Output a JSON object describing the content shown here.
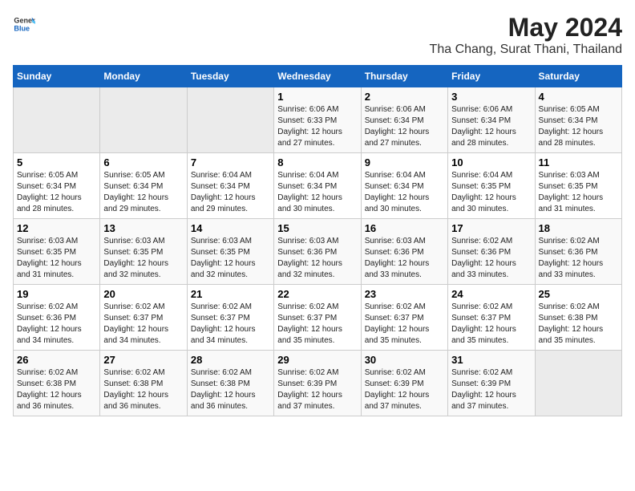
{
  "header": {
    "logo_general": "General",
    "logo_blue": "Blue",
    "title": "May 2024",
    "subtitle": "Tha Chang, Surat Thani, Thailand"
  },
  "days_of_week": [
    "Sunday",
    "Monday",
    "Tuesday",
    "Wednesday",
    "Thursday",
    "Friday",
    "Saturday"
  ],
  "weeks": [
    [
      {
        "day": "",
        "info": ""
      },
      {
        "day": "",
        "info": ""
      },
      {
        "day": "",
        "info": ""
      },
      {
        "day": "1",
        "info": "Sunrise: 6:06 AM\nSunset: 6:33 PM\nDaylight: 12 hours\nand 27 minutes."
      },
      {
        "day": "2",
        "info": "Sunrise: 6:06 AM\nSunset: 6:34 PM\nDaylight: 12 hours\nand 27 minutes."
      },
      {
        "day": "3",
        "info": "Sunrise: 6:06 AM\nSunset: 6:34 PM\nDaylight: 12 hours\nand 28 minutes."
      },
      {
        "day": "4",
        "info": "Sunrise: 6:05 AM\nSunset: 6:34 PM\nDaylight: 12 hours\nand 28 minutes."
      }
    ],
    [
      {
        "day": "5",
        "info": "Sunrise: 6:05 AM\nSunset: 6:34 PM\nDaylight: 12 hours\nand 28 minutes."
      },
      {
        "day": "6",
        "info": "Sunrise: 6:05 AM\nSunset: 6:34 PM\nDaylight: 12 hours\nand 29 minutes."
      },
      {
        "day": "7",
        "info": "Sunrise: 6:04 AM\nSunset: 6:34 PM\nDaylight: 12 hours\nand 29 minutes."
      },
      {
        "day": "8",
        "info": "Sunrise: 6:04 AM\nSunset: 6:34 PM\nDaylight: 12 hours\nand 30 minutes."
      },
      {
        "day": "9",
        "info": "Sunrise: 6:04 AM\nSunset: 6:34 PM\nDaylight: 12 hours\nand 30 minutes."
      },
      {
        "day": "10",
        "info": "Sunrise: 6:04 AM\nSunset: 6:35 PM\nDaylight: 12 hours\nand 30 minutes."
      },
      {
        "day": "11",
        "info": "Sunrise: 6:03 AM\nSunset: 6:35 PM\nDaylight: 12 hours\nand 31 minutes."
      }
    ],
    [
      {
        "day": "12",
        "info": "Sunrise: 6:03 AM\nSunset: 6:35 PM\nDaylight: 12 hours\nand 31 minutes."
      },
      {
        "day": "13",
        "info": "Sunrise: 6:03 AM\nSunset: 6:35 PM\nDaylight: 12 hours\nand 32 minutes."
      },
      {
        "day": "14",
        "info": "Sunrise: 6:03 AM\nSunset: 6:35 PM\nDaylight: 12 hours\nand 32 minutes."
      },
      {
        "day": "15",
        "info": "Sunrise: 6:03 AM\nSunset: 6:36 PM\nDaylight: 12 hours\nand 32 minutes."
      },
      {
        "day": "16",
        "info": "Sunrise: 6:03 AM\nSunset: 6:36 PM\nDaylight: 12 hours\nand 33 minutes."
      },
      {
        "day": "17",
        "info": "Sunrise: 6:02 AM\nSunset: 6:36 PM\nDaylight: 12 hours\nand 33 minutes."
      },
      {
        "day": "18",
        "info": "Sunrise: 6:02 AM\nSunset: 6:36 PM\nDaylight: 12 hours\nand 33 minutes."
      }
    ],
    [
      {
        "day": "19",
        "info": "Sunrise: 6:02 AM\nSunset: 6:36 PM\nDaylight: 12 hours\nand 34 minutes."
      },
      {
        "day": "20",
        "info": "Sunrise: 6:02 AM\nSunset: 6:37 PM\nDaylight: 12 hours\nand 34 minutes."
      },
      {
        "day": "21",
        "info": "Sunrise: 6:02 AM\nSunset: 6:37 PM\nDaylight: 12 hours\nand 34 minutes."
      },
      {
        "day": "22",
        "info": "Sunrise: 6:02 AM\nSunset: 6:37 PM\nDaylight: 12 hours\nand 35 minutes."
      },
      {
        "day": "23",
        "info": "Sunrise: 6:02 AM\nSunset: 6:37 PM\nDaylight: 12 hours\nand 35 minutes."
      },
      {
        "day": "24",
        "info": "Sunrise: 6:02 AM\nSunset: 6:37 PM\nDaylight: 12 hours\nand 35 minutes."
      },
      {
        "day": "25",
        "info": "Sunrise: 6:02 AM\nSunset: 6:38 PM\nDaylight: 12 hours\nand 35 minutes."
      }
    ],
    [
      {
        "day": "26",
        "info": "Sunrise: 6:02 AM\nSunset: 6:38 PM\nDaylight: 12 hours\nand 36 minutes."
      },
      {
        "day": "27",
        "info": "Sunrise: 6:02 AM\nSunset: 6:38 PM\nDaylight: 12 hours\nand 36 minutes."
      },
      {
        "day": "28",
        "info": "Sunrise: 6:02 AM\nSunset: 6:38 PM\nDaylight: 12 hours\nand 36 minutes."
      },
      {
        "day": "29",
        "info": "Sunrise: 6:02 AM\nSunset: 6:39 PM\nDaylight: 12 hours\nand 37 minutes."
      },
      {
        "day": "30",
        "info": "Sunrise: 6:02 AM\nSunset: 6:39 PM\nDaylight: 12 hours\nand 37 minutes."
      },
      {
        "day": "31",
        "info": "Sunrise: 6:02 AM\nSunset: 6:39 PM\nDaylight: 12 hours\nand 37 minutes."
      },
      {
        "day": "",
        "info": ""
      }
    ]
  ]
}
